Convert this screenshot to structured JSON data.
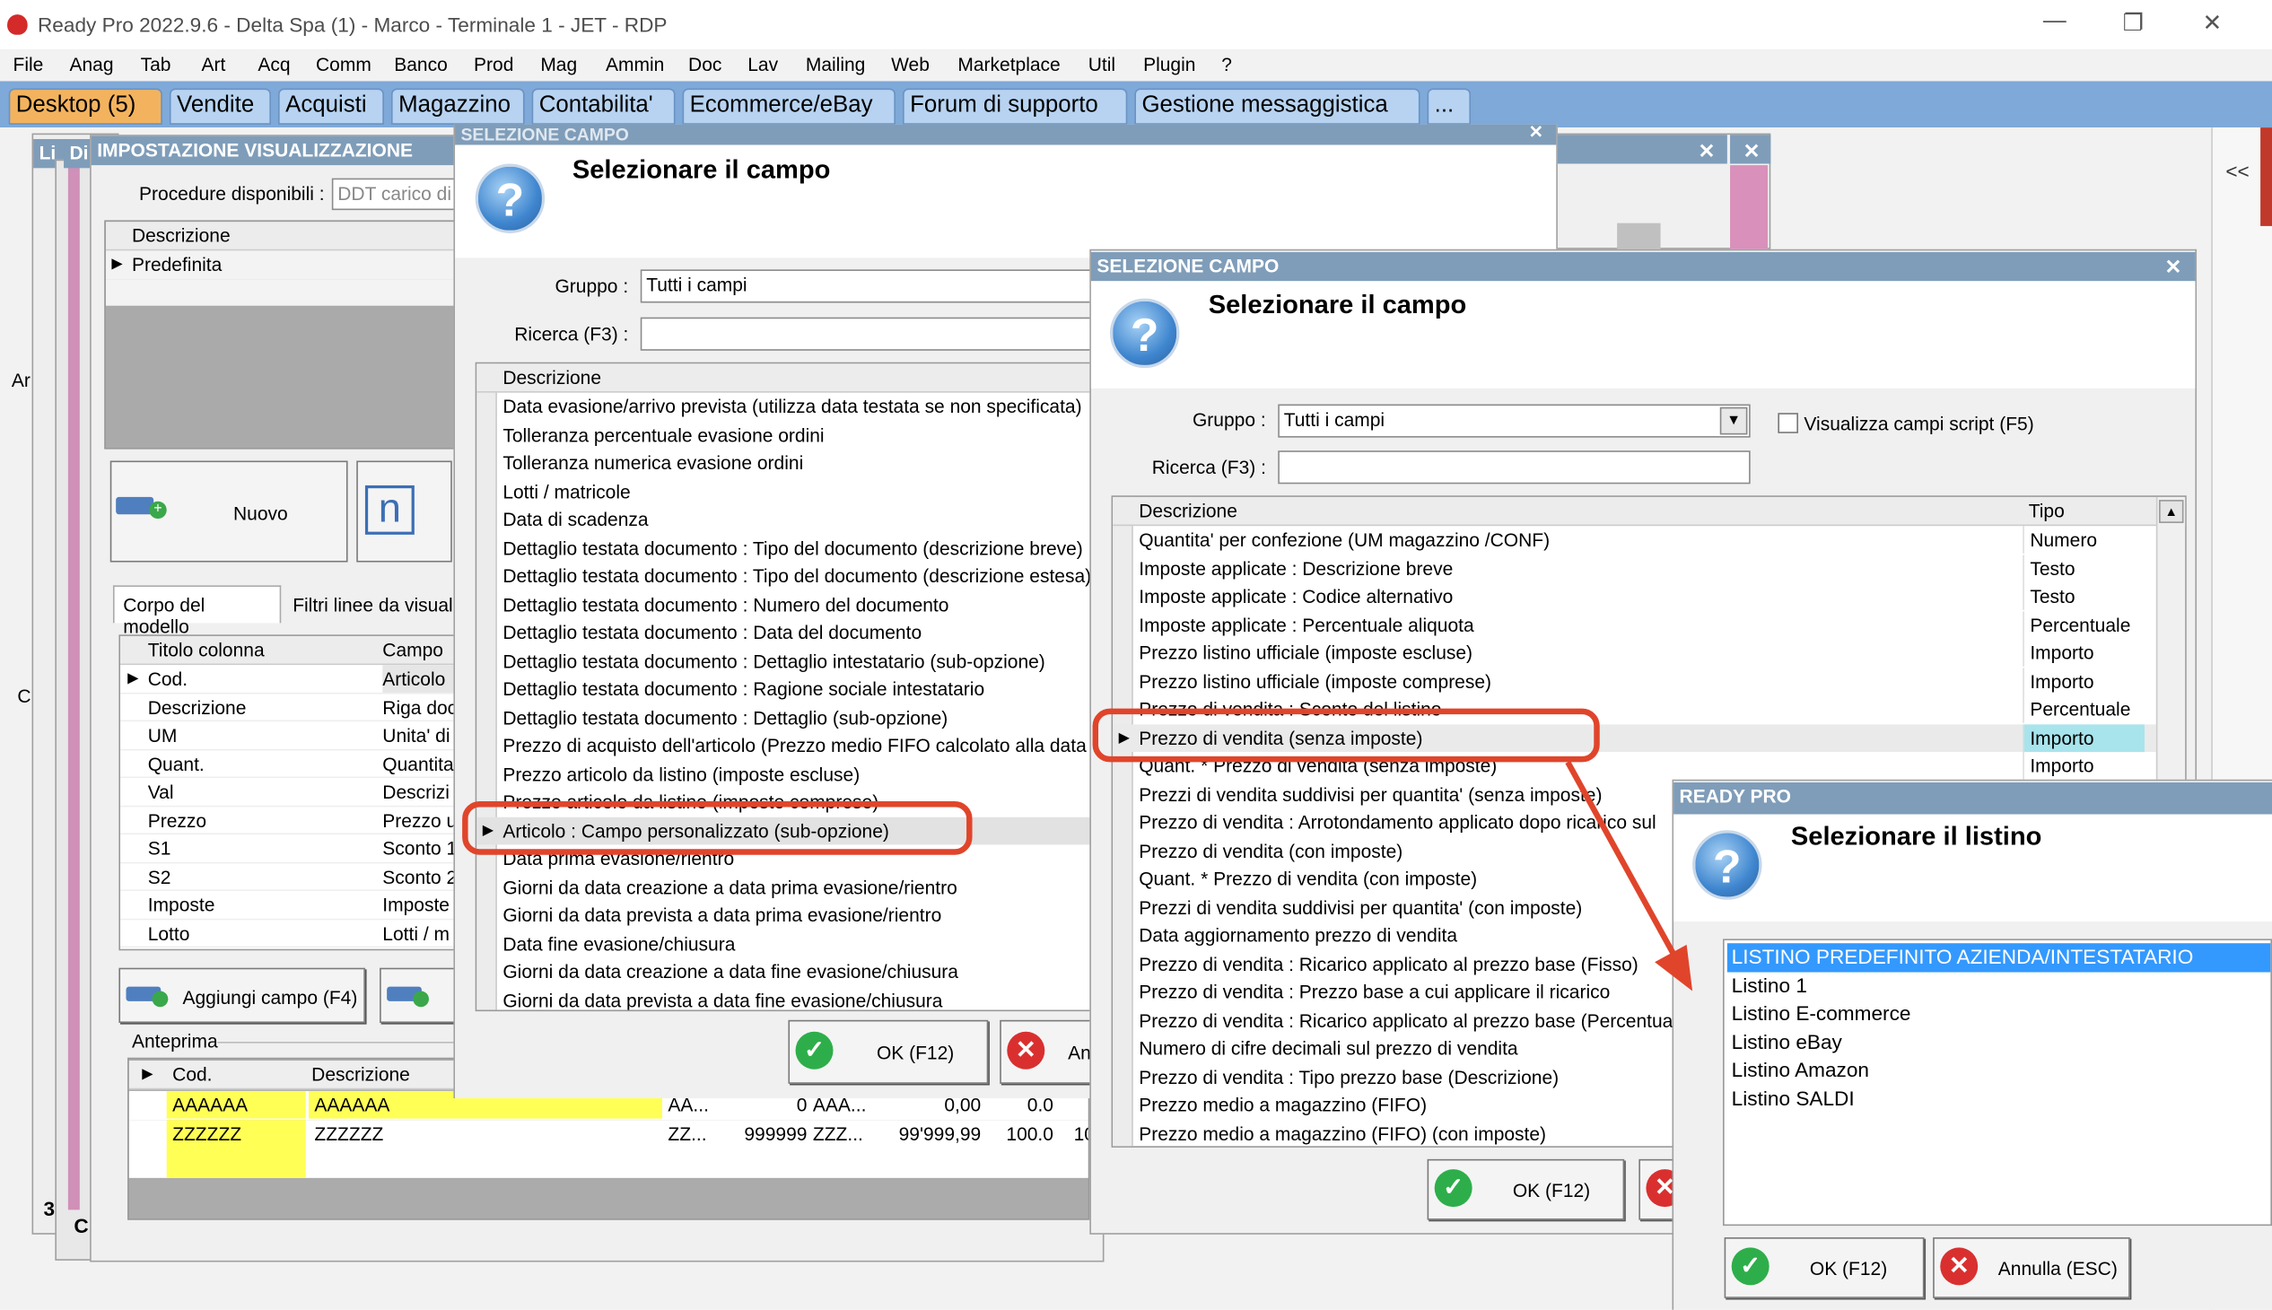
{
  "window": {
    "title": "Ready Pro 2022.9.6 - Delta Spa (1) - Marco - Terminale 1 - JET - RDP",
    "min": "—",
    "max": "❐",
    "close": "✕"
  },
  "menu": [
    "File",
    "Anag",
    "Tab",
    "Art",
    "Acq",
    "Comm",
    "Banco",
    "Prod",
    "Mag",
    "Ammin",
    "Doc",
    "Lav",
    "Mailing",
    "Web",
    "Marketplace",
    "Util",
    "Plugin",
    "?"
  ],
  "tabs": [
    "Desktop (5)",
    "Vendite",
    "Acquisti",
    "Magazzino",
    "Contabilita'",
    "Ecommerce/eBay",
    "Forum di supporto",
    "Gestione messaggistica",
    "..."
  ],
  "side": {
    "collapse": "<<",
    "frag_ar": "Ar",
    "frag_c": "C",
    "frag_3": "3",
    "frag_c2": "C",
    "frag_li": "Li",
    "frag_di": "Di"
  },
  "impostazione": {
    "title": "IMPOSTAZIONE VISUALIZZAZIONE",
    "procedure_label": "Procedure disponibili :",
    "procedure_value": "DDT carico di",
    "list_header": "Descrizione",
    "list_item": "Predefinita",
    "nuovo": "Nuovo",
    "tabs": [
      "Corpo del modello",
      "Filtri linee da visual"
    ],
    "col_header": [
      "Titolo colonna",
      "Campo"
    ],
    "rows": [
      [
        "Cod.",
        "Articolo"
      ],
      [
        "Descrizione",
        "Riga doc"
      ],
      [
        "UM",
        "Unita' di"
      ],
      [
        "Quant.",
        "Quantita"
      ],
      [
        "Val",
        "Descrizi"
      ],
      [
        "Prezzo",
        "Prezzo u"
      ],
      [
        "S1",
        "Sconto 1"
      ],
      [
        "S2",
        "Sconto 2"
      ],
      [
        "Imposte",
        "Imposte"
      ],
      [
        "Lotto",
        "Lotti / m"
      ]
    ],
    "add_button": "Aggiungi campo (F4)",
    "anteprima": "Anteprima",
    "preview_header": [
      "Cod.",
      "Descrizione"
    ],
    "preview_rows": [
      [
        "AAAAAA",
        "AAAAAA",
        "AA...",
        "0",
        "AAA...",
        "0,00",
        "0.0"
      ],
      [
        "ZZZZZZ",
        "ZZZZZZ",
        "ZZ...",
        "999999",
        "ZZZ...",
        "99'999,99",
        "100.0",
        "10"
      ]
    ]
  },
  "dlg1": {
    "title": "SELEZIONE CAMPO",
    "heading": "Selezionare il campo",
    "gruppo_label": "Gruppo :",
    "gruppo_value": "Tutti i campi",
    "ricerca_label": "Ricerca (F3) :",
    "header": "Descrizione",
    "rows": [
      "Data evasione/arrivo prevista (utilizza data testata se non specificata)",
      "Tolleranza percentuale evasione ordini",
      "Tolleranza numerica evasione ordini",
      "Lotti / matricole",
      "Data di scadenza",
      "Dettaglio testata documento : Tipo del documento (descrizione breve)",
      "Dettaglio testata documento : Tipo del documento (descrizione estesa)",
      "Dettaglio testata documento : Numero del documento",
      "Dettaglio testata documento : Data del documento",
      "Dettaglio testata documento : Dettaglio intestatario (sub-opzione)",
      "Dettaglio testata documento : Ragione sociale intestatario",
      "Dettaglio testata documento : Dettaglio (sub-opzione)",
      "Prezzo di acquisto dell'articolo (Prezzo medio FIFO calcolato alla data",
      "Prezzo articolo da listino (imposte escluse)",
      "Prezzo articolo da listino (imposte comprese)",
      "Articolo : Campo personalizzato (sub-opzione)",
      "Data prima evasione/rientro",
      "Giorni da data creazione a data prima evasione/rientro",
      "Giorni da data prevista a data prima evasione/rientro",
      "Data fine evasione/chiusura",
      "Giorni da data creazione a data fine evasione/chiusura",
      "Giorni da data prevista a data fine evasione/chiusura"
    ],
    "ok": "OK (F12)",
    "annulla": "An"
  },
  "dlg2": {
    "title": "SELEZIONE CAMPO",
    "heading": "Selezionare il campo",
    "gruppo_label": "Gruppo :",
    "gruppo_value": "Tutti i campi",
    "script_label": "Visualizza campi script (F5)",
    "ricerca_label": "Ricerca (F3) :",
    "header": [
      "Descrizione",
      "Tipo"
    ],
    "rows": [
      [
        "Quantita' per confezione (UM magazzino /CONF)",
        "Numero"
      ],
      [
        "Imposte applicate : Descrizione breve",
        "Testo"
      ],
      [
        "Imposte applicate : Codice alternativo",
        "Testo"
      ],
      [
        "Imposte applicate : Percentuale aliquota",
        "Percentuale"
      ],
      [
        "Prezzo listino ufficiale (imposte escluse)",
        "Importo"
      ],
      [
        "Prezzo listino ufficiale (imposte comprese)",
        "Importo"
      ],
      [
        "Prezzo di vendita : Sconto del listino",
        "Percentuale"
      ],
      [
        "Prezzo di vendita (senza imposte)",
        "Importo"
      ],
      [
        "Quant. * Prezzo di vendita (senza imposte)",
        "Importo"
      ],
      [
        "Prezzi di vendita suddivisi per quantita' (senza imposte)",
        ""
      ],
      [
        "Prezzo di vendita : Arrotondamento applicato dopo ricarico sul",
        ""
      ],
      [
        "Prezzo di vendita (con imposte)",
        ""
      ],
      [
        "Quant. * Prezzo di vendita (con imposte)",
        ""
      ],
      [
        "Prezzi di vendita suddivisi per quantita' (con imposte)",
        ""
      ],
      [
        "Data aggiornamento prezzo di vendita",
        ""
      ],
      [
        "Prezzo di vendita : Ricarico applicato al prezzo base (Fisso)",
        ""
      ],
      [
        "Prezzo di vendita : Prezzo base a cui applicare il ricarico",
        ""
      ],
      [
        "Prezzo di vendita : Ricarico applicato al prezzo base (Percentuale)",
        ""
      ],
      [
        "Numero di cifre decimali sul prezzo di vendita",
        ""
      ],
      [
        "Prezzo di vendita : Tipo prezzo base (Descrizione)",
        ""
      ],
      [
        "Prezzo medio a magazzino (FIFO)",
        ""
      ],
      [
        "Prezzo medio a magazzino (FIFO) (con imposte)",
        ""
      ]
    ],
    "ok": "OK (F12)"
  },
  "dlg3": {
    "title": "READY PRO",
    "heading": "Selezionare il listino",
    "items": [
      "LISTINO PREDEFINITO AZIENDA/INTESTATARIO",
      "Listino 1",
      "Listino E-commerce",
      "Listino eBay",
      "Listino Amazon",
      "Listino SALDI"
    ],
    "ok": "OK (F12)",
    "annulla": "Annulla (ESC)"
  },
  "colors": {
    "title_bar": "#7f9db9",
    "tab_bar": "#7ea9d8",
    "tab_active": "#f3b35e",
    "highlight": "#e0452b",
    "selected_row": "#3399ff",
    "selected_tipo": "#a8e4ec",
    "preview_yellow": "#ffff55"
  }
}
